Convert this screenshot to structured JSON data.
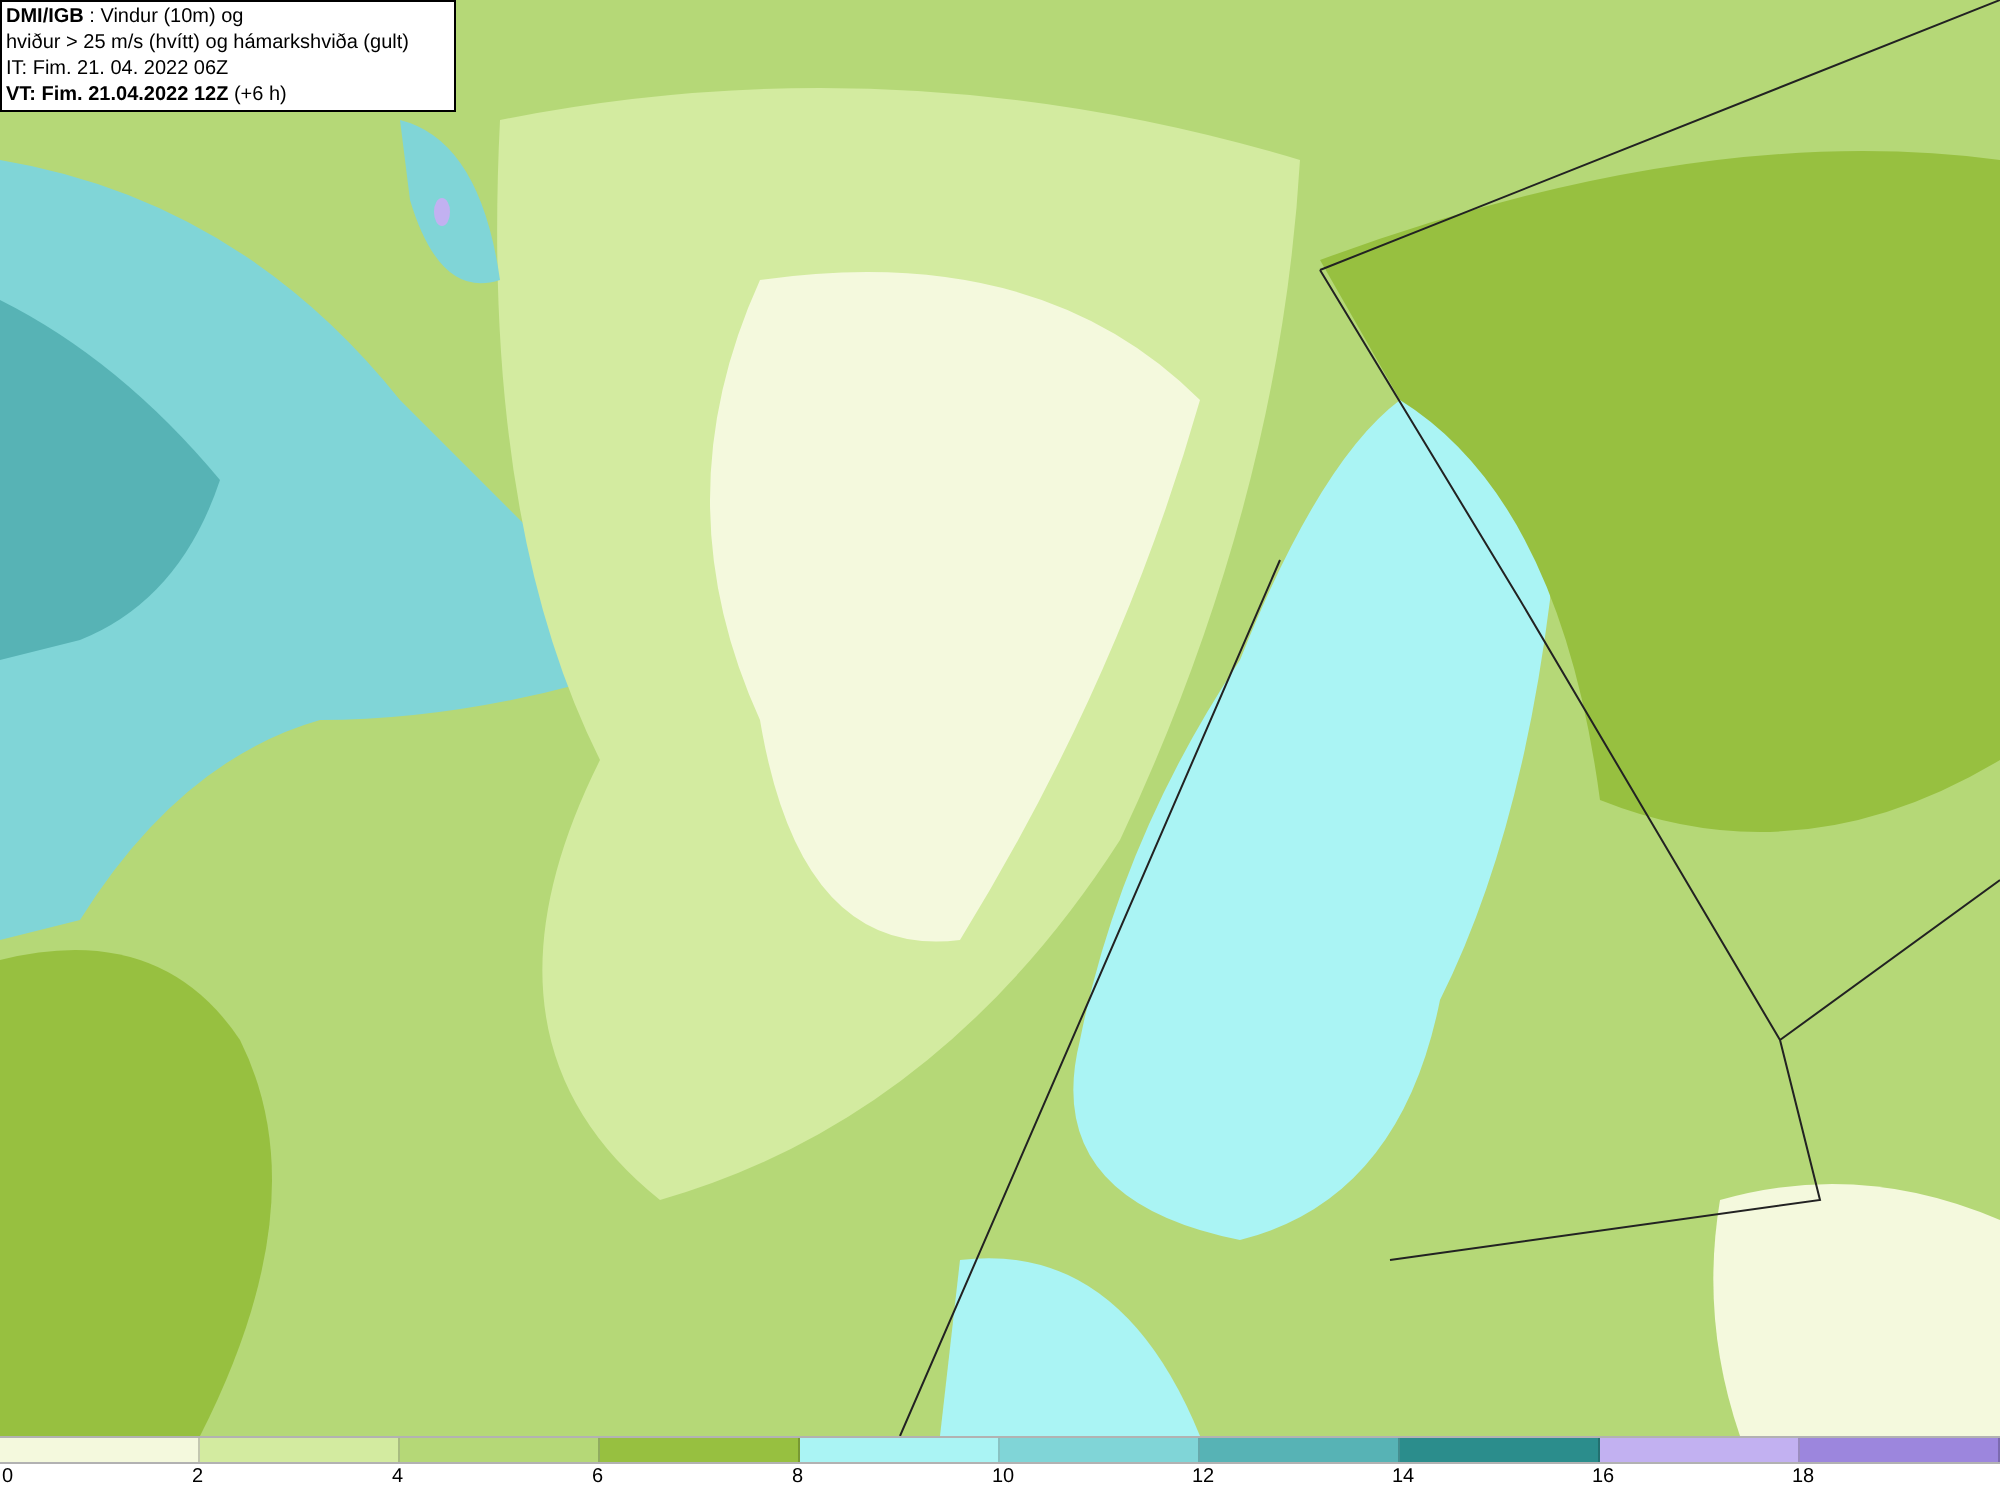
{
  "header": {
    "lines": [
      "**DMI/IGB** : Vindur (10m) og",
      "hviður > 25 m/s (hvítt) og hámarkshviða (gult)",
      "IT: Fim. 21. 04. 2022 06Z",
      "**VT: Fim. 21.04.2022 12Z** (+6 h)"
    ]
  },
  "legend": {
    "segments": [
      {
        "color": "#f4f9dd"
      },
      {
        "color": "#d3eba0"
      },
      {
        "color": "#b5d877"
      },
      {
        "color": "#97c040"
      },
      {
        "color": "#aaf4f4"
      },
      {
        "color": "#80d5d7"
      },
      {
        "color": "#57b3b5"
      },
      {
        "color": "#2b8d8c"
      },
      {
        "color": "#c2b1f1"
      },
      {
        "color": "#9c86dd"
      }
    ],
    "ticks": [
      "0",
      "2",
      "4",
      "6",
      "8",
      "10",
      "12",
      "14",
      "16",
      "18"
    ]
  }
}
